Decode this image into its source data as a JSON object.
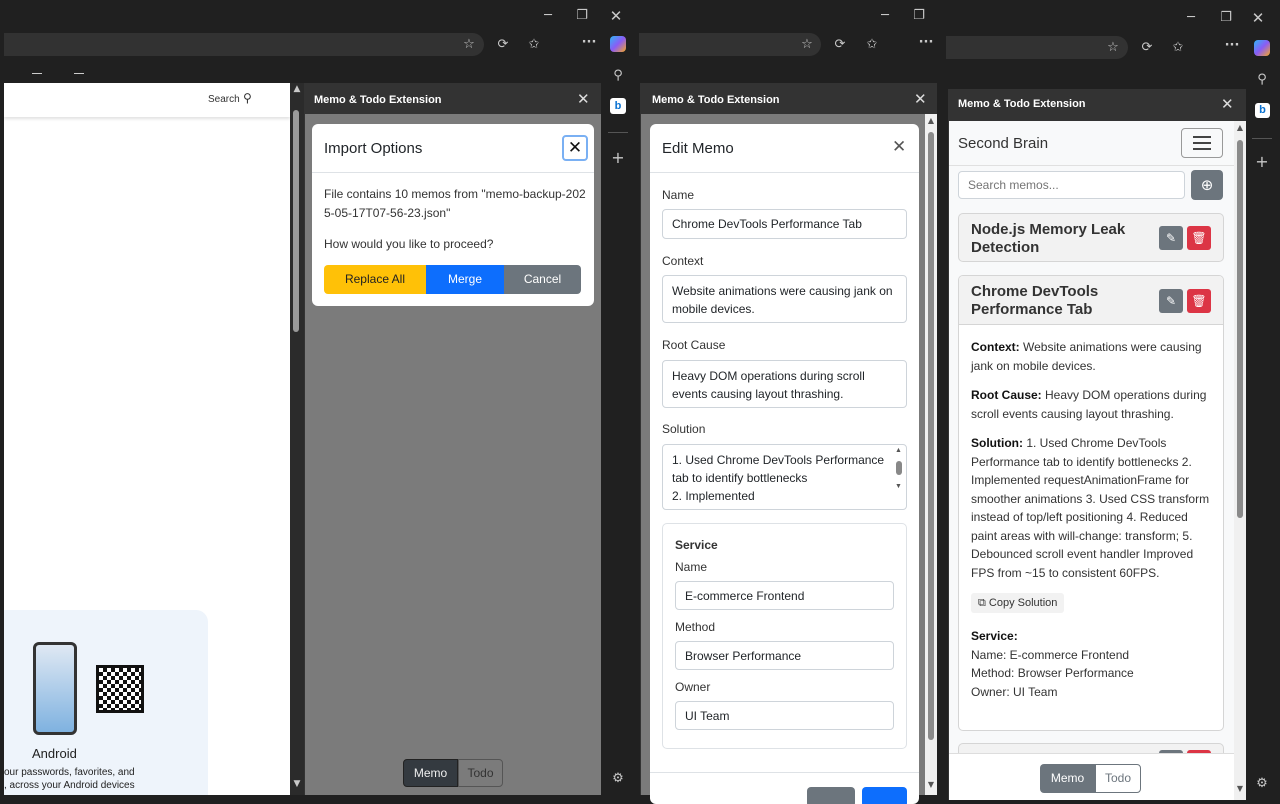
{
  "browser": {
    "copilot_icon": "copilot-icon",
    "bing_icon": "bing-icon"
  },
  "left": {
    "search_label": "Search",
    "android_label": "Android",
    "android_text_1": "our passwords, favorites, and",
    "android_text_2": ", across your Android devices"
  },
  "panel1": {
    "title": "Memo & Todo Extension",
    "modal_title": "Import Options",
    "message": "File contains 10 memos from \"memo-backup-2025-05-17T07-56-23.json\"",
    "question": "How would you like to proceed?",
    "btn_replace": "Replace All",
    "btn_merge": "Merge",
    "btn_cancel": "Cancel",
    "tab_memo": "Memo",
    "tab_todo": "Todo"
  },
  "panel2": {
    "title": "Memo & Todo Extension",
    "modal_title": "Edit Memo",
    "name_label": "Name",
    "name_value": "Chrome DevTools Performance Tab",
    "context_label": "Context",
    "context_value": "Website animations were causing jank on mobile devices.",
    "rootcause_label": "Root Cause",
    "rootcause_value": "Heavy DOM operations during scroll events causing layout thrashing.",
    "solution_label": "Solution",
    "solution_line1": "1. Used Chrome DevTools Performance tab to identify bottlenecks",
    "solution_line2": "2. Implemented",
    "service_title": "Service",
    "service_name_label": "Name",
    "service_name_value": "E-commerce Frontend",
    "service_method_label": "Method",
    "service_method_value": "Browser Performance",
    "service_owner_label": "Owner",
    "service_owner_value": "UI Team"
  },
  "panel3": {
    "title": "Memo & Todo Extension",
    "brand": "Second Brain",
    "search_placeholder": "Search memos...",
    "memo1_title": "Node.js Memory Leak Detection",
    "memo2_title": "Chrome DevTools Performance Tab",
    "context_label": "Context:",
    "context_text": " Website animations were causing jank on mobile devices.",
    "rootcause_label": "Root Cause:",
    "rootcause_text": " Heavy DOM operations during scroll events causing layout thrashing.",
    "solution_label": "Solution:",
    "solution_text": " 1. Used Chrome DevTools Performance tab to identify bottlenecks 2. Implemented requestAnimationFrame for smoother animations 3. Used CSS transform instead of top/left positioning 4. Reduced paint areas with will-change: transform; 5. Debounced scroll event handler Improved FPS from ~15 to consistent 60FPS.",
    "copy_label": "Copy Solution",
    "service_label": "Service:",
    "service_name": "Name: E-commerce Frontend",
    "service_method": "Method: Browser Performance",
    "service_owner": "Owner: UI Team",
    "tab_memo": "Memo",
    "tab_todo": "Todo"
  },
  "colors": {
    "warning": "#ffc107",
    "primary": "#0d6efd",
    "secondary": "#6c757d",
    "danger": "#dc3545"
  }
}
